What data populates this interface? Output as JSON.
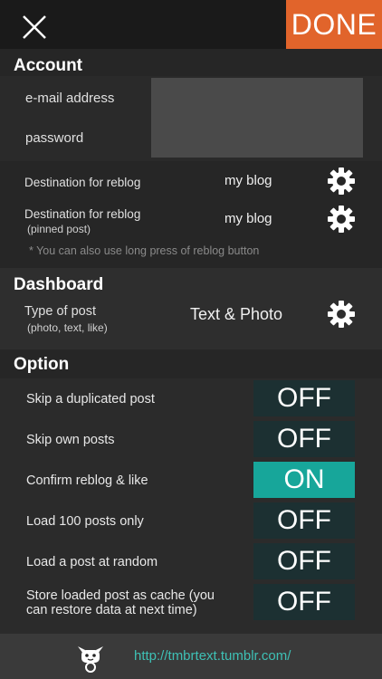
{
  "header": {
    "done_label": "DONE"
  },
  "account": {
    "title": "Account",
    "email_label": "e-mail address",
    "email_value": "",
    "password_label": "password",
    "password_value": "",
    "reblog_dest_label": "Destination for reblog",
    "reblog_dest_value": "my blog",
    "reblog_pinned_label": "Destination for reblog",
    "reblog_pinned_sub": "(pinned post)",
    "reblog_pinned_value": "my blog",
    "note": "* You can also use long press of reblog button"
  },
  "dashboard": {
    "title": "Dashboard",
    "type_label": "Type of post",
    "type_sub": "(photo, text, like)",
    "type_value": "Text & Photo"
  },
  "option": {
    "title": "Option",
    "items": [
      {
        "label": "Skip a duplicated post",
        "state": "OFF"
      },
      {
        "label": "Skip own posts",
        "state": "OFF"
      },
      {
        "label": "Confirm reblog & like",
        "state": "ON"
      },
      {
        "label": "Load 100 posts only",
        "state": "OFF"
      },
      {
        "label": "Load a post at random",
        "state": "OFF"
      },
      {
        "label": "Store loaded post as cache (you",
        "label2": "can restore data at next time)",
        "state": "OFF"
      }
    ]
  },
  "footer": {
    "url": "http://tmbrtext.tumblr.com/"
  },
  "colors": {
    "accent": "#e1642b",
    "toggle_on": "#17a69a",
    "toggle_off": "#1c3032",
    "link": "#3ec0b5"
  }
}
